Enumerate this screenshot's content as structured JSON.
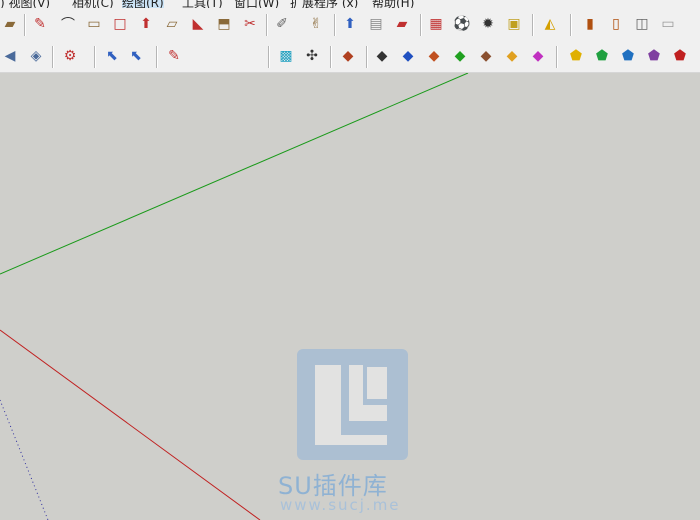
{
  "menu": {
    "items": [
      {
        "label": ") 视图(V)"
      },
      {
        "label": "相机(C)"
      },
      {
        "label": "绘图(R)",
        "active": true
      },
      {
        "label": "工具(T)"
      },
      {
        "label": "窗口(W)"
      },
      {
        "label": "扩展程序 (x)"
      },
      {
        "label": "帮助(H)"
      }
    ]
  },
  "toolbar_row1_icons": [
    "paint-bucket-icon",
    "eraser-icon",
    "arc-icon",
    "rectangle-icon",
    "push-pull-icon",
    "move-icon",
    "rotate-icon",
    "follow-me-icon",
    "offset-icon",
    "tape-measure-icon",
    "dimension-icon",
    "protractor-icon",
    "text-icon",
    "axes-icon",
    "3d-text-icon",
    "section-icon",
    "display-section-icon",
    "materials-icon",
    "styles-icon",
    "shadows-icon",
    "components-icon",
    "scale-icon",
    "door-icon",
    "window-icon",
    "wall-icon"
  ],
  "toolbar_row2_icons": [
    "orbit-icon",
    "pan-icon",
    "zoom-extents-icon",
    "select-icon",
    "lasso-icon",
    "note-icon",
    "gradient-icon",
    "cursor-icon",
    "sandbox-icon",
    "arrow-red-icon",
    "arrow-blue-icon",
    "arrow-orange-icon",
    "arrow-green-icon",
    "arrow-dark-icon",
    "arrow-yellow-icon",
    "arrow-magenta-icon",
    "house-yellow-icon",
    "house-green-icon",
    "house-blue-icon",
    "house-purple-icon",
    "house-red-icon"
  ],
  "watermark": {
    "text": "SU插件库",
    "url": "www.sucj.me"
  },
  "colors": {
    "green_axis": "#1a9a1a",
    "red_axis": "#c02020",
    "blue_axis": "#3030a0"
  }
}
